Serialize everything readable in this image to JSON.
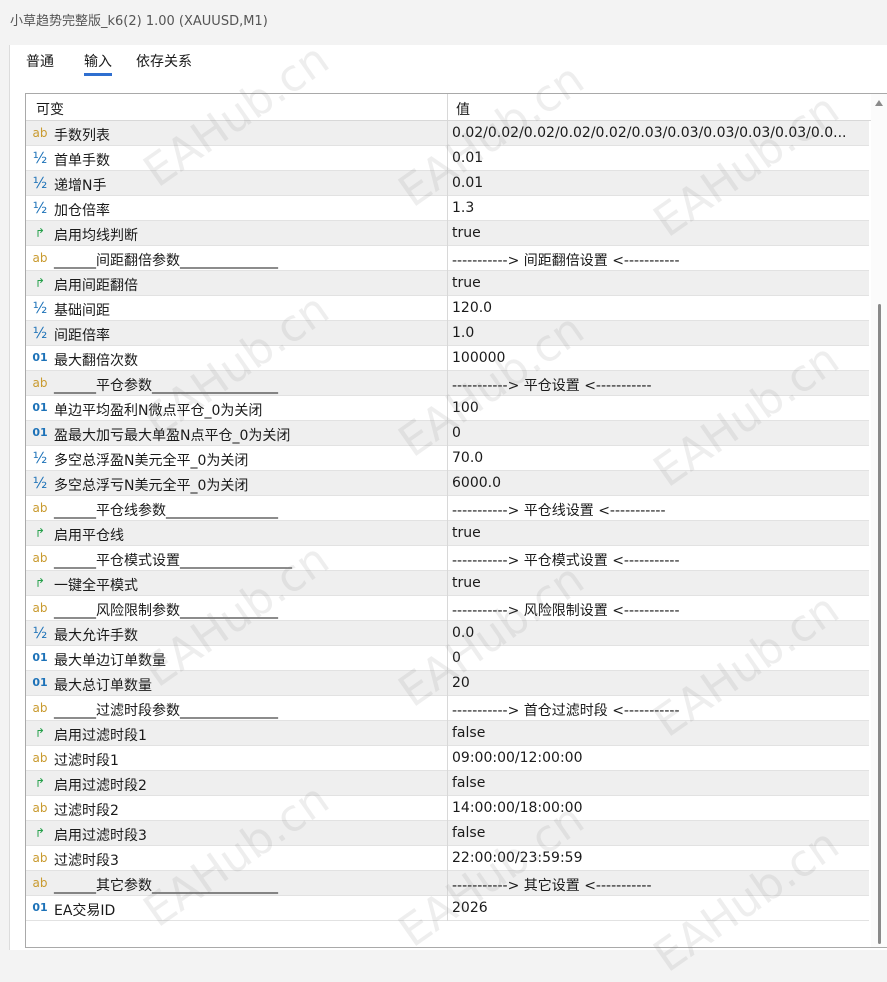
{
  "window": {
    "title": "小草趋势完整版_k6(2) 1.00 (XAUUSD,M1)"
  },
  "tabs": [
    {
      "label": "普通"
    },
    {
      "label": "输入"
    },
    {
      "label": "依存关系"
    }
  ],
  "active_tab": "输入",
  "table": {
    "headers": {
      "variable": "可变",
      "value": "值"
    },
    "rows": [
      {
        "icon": "ab",
        "name": "手数列表",
        "value": "0.02/0.02/0.02/0.02/0.02/0.03/0.03/0.03/0.03/0.03/0.0..."
      },
      {
        "icon": "half",
        "name": "首单手数",
        "value": "0.01"
      },
      {
        "icon": "half",
        "name": "递增N手",
        "value": "0.01"
      },
      {
        "icon": "half",
        "name": "加仓倍率",
        "value": "1.3"
      },
      {
        "icon": "bool",
        "name": "启用均线判断",
        "value": "true"
      },
      {
        "icon": "ab",
        "name": "______间距翻倍参数______________",
        "value": "-----------> 间距翻倍设置 <-----------"
      },
      {
        "icon": "bool",
        "name": "启用间距翻倍",
        "value": "true"
      },
      {
        "icon": "half",
        "name": "基础间距",
        "value": "120.0"
      },
      {
        "icon": "half",
        "name": "间距倍率",
        "value": "1.0"
      },
      {
        "icon": "num",
        "name": "最大翻倍次数",
        "value": "100000"
      },
      {
        "icon": "ab",
        "name": "______平仓参数__________________",
        "value": "-----------> 平仓设置 <-----------"
      },
      {
        "icon": "num",
        "name": "单边平均盈利N微点平仓_0为关闭",
        "value": "100"
      },
      {
        "icon": "num",
        "name": "盈最大加亏最大单盈N点平仓_0为关闭",
        "value": "0"
      },
      {
        "icon": "half",
        "name": "多空总浮盈N美元全平_0为关闭",
        "value": "70.0"
      },
      {
        "icon": "half",
        "name": "多空总浮亏N美元全平_0为关闭",
        "value": "6000.0"
      },
      {
        "icon": "ab",
        "name": "______平仓线参数________________",
        "value": "-----------> 平仓线设置 <-----------"
      },
      {
        "icon": "bool",
        "name": "启用平仓线",
        "value": "true"
      },
      {
        "icon": "ab",
        "name": "______平仓模式设置________________",
        "value": "-----------> 平仓模式设置 <-----------"
      },
      {
        "icon": "bool",
        "name": "一键全平模式",
        "value": "true"
      },
      {
        "icon": "ab",
        "name": "______风险限制参数______________",
        "value": "-----------> 风险限制设置 <-----------"
      },
      {
        "icon": "half",
        "name": "最大允许手数",
        "value": "0.0"
      },
      {
        "icon": "num",
        "name": "最大单边订单数量",
        "value": "0"
      },
      {
        "icon": "num",
        "name": "最大总订单数量",
        "value": "20"
      },
      {
        "icon": "ab",
        "name": "______过滤时段参数______________",
        "value": "-----------> 首仓过滤时段 <-----------"
      },
      {
        "icon": "bool",
        "name": "启用过滤时段1",
        "value": "false"
      },
      {
        "icon": "ab",
        "name": "过滤时段1",
        "value": "09:00:00/12:00:00"
      },
      {
        "icon": "bool",
        "name": "启用过滤时段2",
        "value": "false"
      },
      {
        "icon": "ab",
        "name": "过滤时段2",
        "value": "14:00:00/18:00:00"
      },
      {
        "icon": "bool",
        "name": "启用过滤时段3",
        "value": "false"
      },
      {
        "icon": "ab",
        "name": "过滤时段3",
        "value": "22:00:00/23:59:59"
      },
      {
        "icon": "ab",
        "name": "______其它参数__________________",
        "value": "-----------> 其它设置 <-----------"
      },
      {
        "icon": "num",
        "name": "EA交易ID",
        "value": "2026"
      }
    ]
  },
  "icons": {
    "ab": {
      "glyph": "ab",
      "name": "string-type-icon"
    },
    "half": {
      "glyph": "½",
      "name": "double-type-icon"
    },
    "num": {
      "glyph": "01",
      "name": "integer-type-icon"
    },
    "bool": {
      "glyph": "↱",
      "name": "bool-type-icon"
    }
  },
  "watermark": "EAHub.cn",
  "colors": {
    "tab_underline": "#2f6fd0",
    "string_icon": "#c99a2e",
    "number_icon": "#1d72b8",
    "bool_icon": "#25a04a",
    "row_alt": "#efefef"
  }
}
